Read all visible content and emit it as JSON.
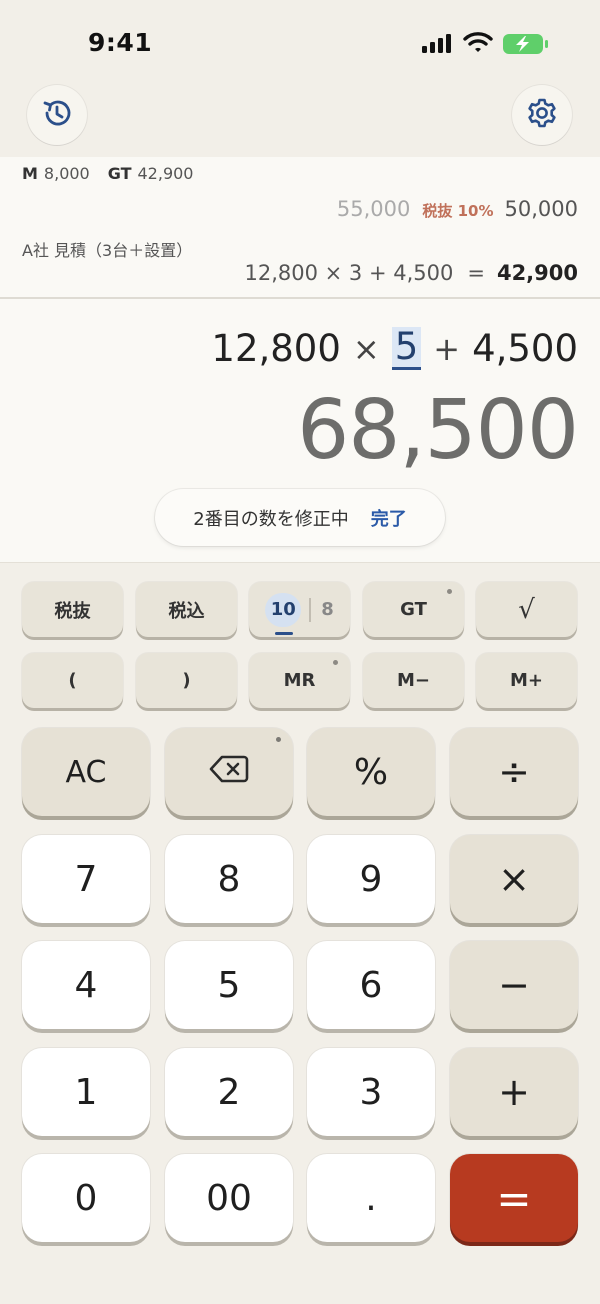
{
  "status_bar": {
    "time": "9:41"
  },
  "icons": {
    "history": "history-icon",
    "settings": "gear-icon",
    "backspace": "backspace-icon"
  },
  "tape": {
    "memory_tag": "M",
    "memory_value": "8,000",
    "gt_tag": "GT",
    "gt_value": "42,900",
    "tax_before": "55,000",
    "tax_label": "税抜 10%",
    "tax_after": "50,000",
    "entry_label": "A社 見積（3台＋設置）",
    "entry_expression": "12,800 × 3 + 4,500",
    "entry_equals": "=",
    "entry_result": "42,900"
  },
  "display": {
    "expression": {
      "operand1": "12,800",
      "operator1": "×",
      "operand2_editing": "5",
      "operator2": "+",
      "operand3": "4,500"
    },
    "result": "68,500",
    "edit_message": "2番目の数を修正中",
    "edit_done": "完了"
  },
  "function_keys": {
    "tax_exclusive": "税抜",
    "tax_inclusive": "税込",
    "radix_active": "10",
    "radix_inactive": "8",
    "grand_total": "GT",
    "sqrt": "√",
    "paren_open": "(",
    "paren_close": ")",
    "memory_recall": "MR",
    "memory_minus": "M−",
    "memory_plus": "M+"
  },
  "keys": {
    "clear": "AC",
    "percent": "%",
    "divide": "÷",
    "multiply": "×",
    "minus": "−",
    "plus": "+",
    "equals": "=",
    "seven": "7",
    "eight": "8",
    "nine": "9",
    "four": "4",
    "five": "5",
    "six": "6",
    "one": "1",
    "two": "2",
    "three": "3",
    "zero": "0",
    "double_zero": "00",
    "decimal": "."
  },
  "colors": {
    "background": "#f2efe8",
    "equals_key": "#b73a20",
    "accent_blue": "#2b4f8a",
    "tax_label": "#c0715a"
  }
}
